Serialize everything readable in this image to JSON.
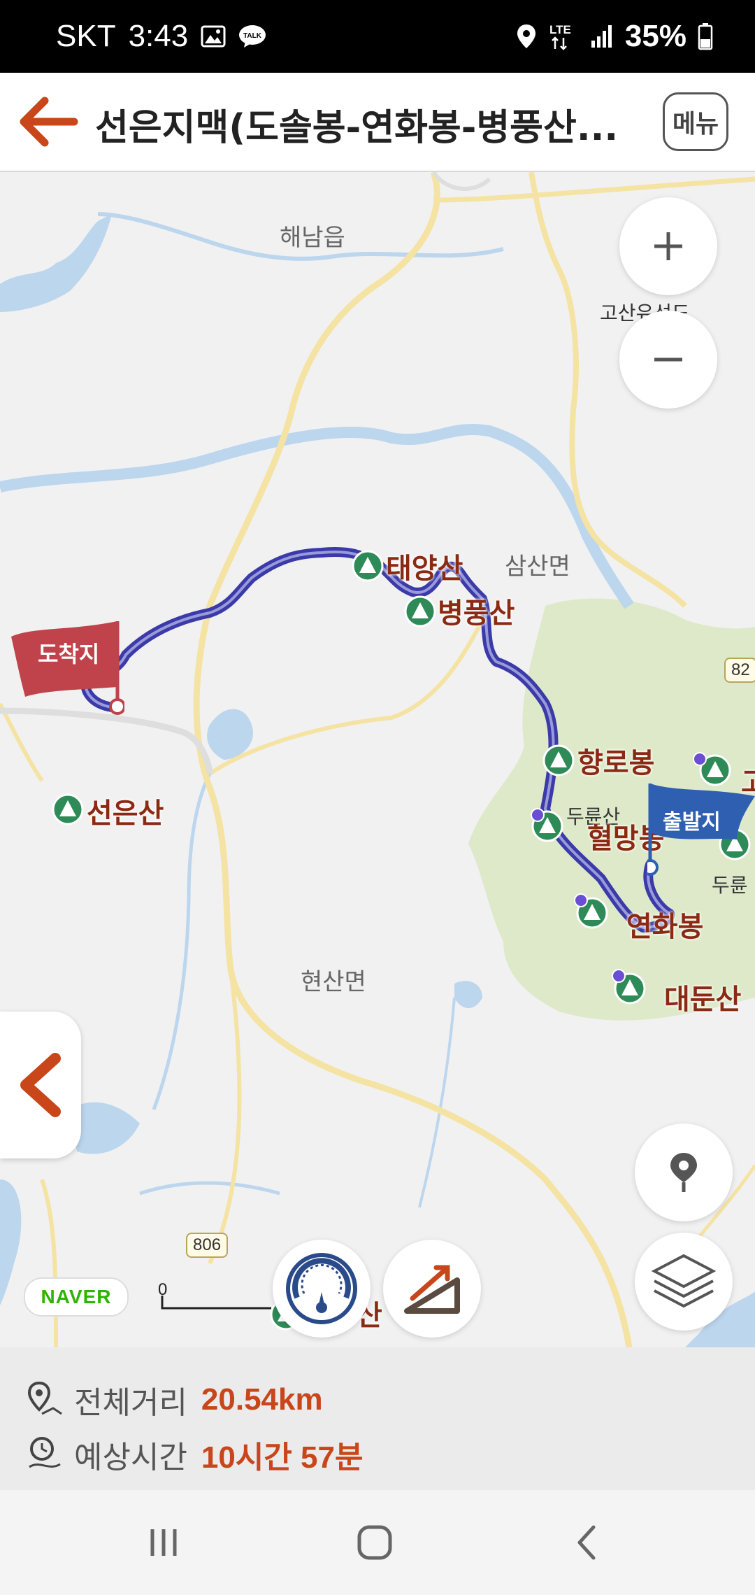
{
  "status_bar": {
    "carrier": "SKT",
    "time": "3:43",
    "network": "LTE",
    "battery": "35%",
    "icons": [
      "image-icon",
      "talk-icon",
      "location-icon",
      "lte-icon",
      "signal-icon",
      "battery-icon"
    ],
    "talk_icon_text": "TALK"
  },
  "header": {
    "title": "선은지맥(도솔봉-연화봉-병풍산...",
    "menu_label": "메뉴",
    "accent_color": "#c8461a"
  },
  "map": {
    "place_labels": {
      "haenam": "해남읍",
      "samsan": "삼산면",
      "hyeonsan": "현산면",
      "gosan": "고산유선도",
      "durunsan": "두륜산",
      "durun2": "두륜",
      "right_edge": "고",
      "bottom_peak_fragment": "산"
    },
    "peaks": {
      "taeyangsan": "태양산",
      "byeongpungsan": "병풍산",
      "hyangrobong": "향로봉",
      "hyeolmangbong": "혈망봉",
      "yeonhwabong": "연화봉",
      "daedunsan": "대둔산",
      "seoneunsan": "선은산"
    },
    "flags": {
      "end_label": "도착지",
      "start_label": "출발지",
      "end_color": "#c0424a",
      "start_color": "#2f5fb0"
    },
    "road_badges": {
      "r806": "806",
      "r82": "82"
    },
    "scale_zero": "0",
    "provider": "NAVER",
    "route_color": "#3a3aa8"
  },
  "controls": {
    "zoom_in_icon": "plus-icon",
    "zoom_out_icon": "minus-icon",
    "location_icon": "location-pin-icon",
    "layers_icon": "layers-icon",
    "speed_icon": "speedometer-icon",
    "elevation_icon": "elevation-icon",
    "side_tab_icon": "chevron-left-icon"
  },
  "summary": {
    "distance_label": "전체거리",
    "distance_value": "20.54km",
    "time_label": "예상시간",
    "time_value": "10시간 57분"
  },
  "nav": {
    "icons": [
      "recent-apps-icon",
      "home-icon",
      "back-icon"
    ]
  }
}
